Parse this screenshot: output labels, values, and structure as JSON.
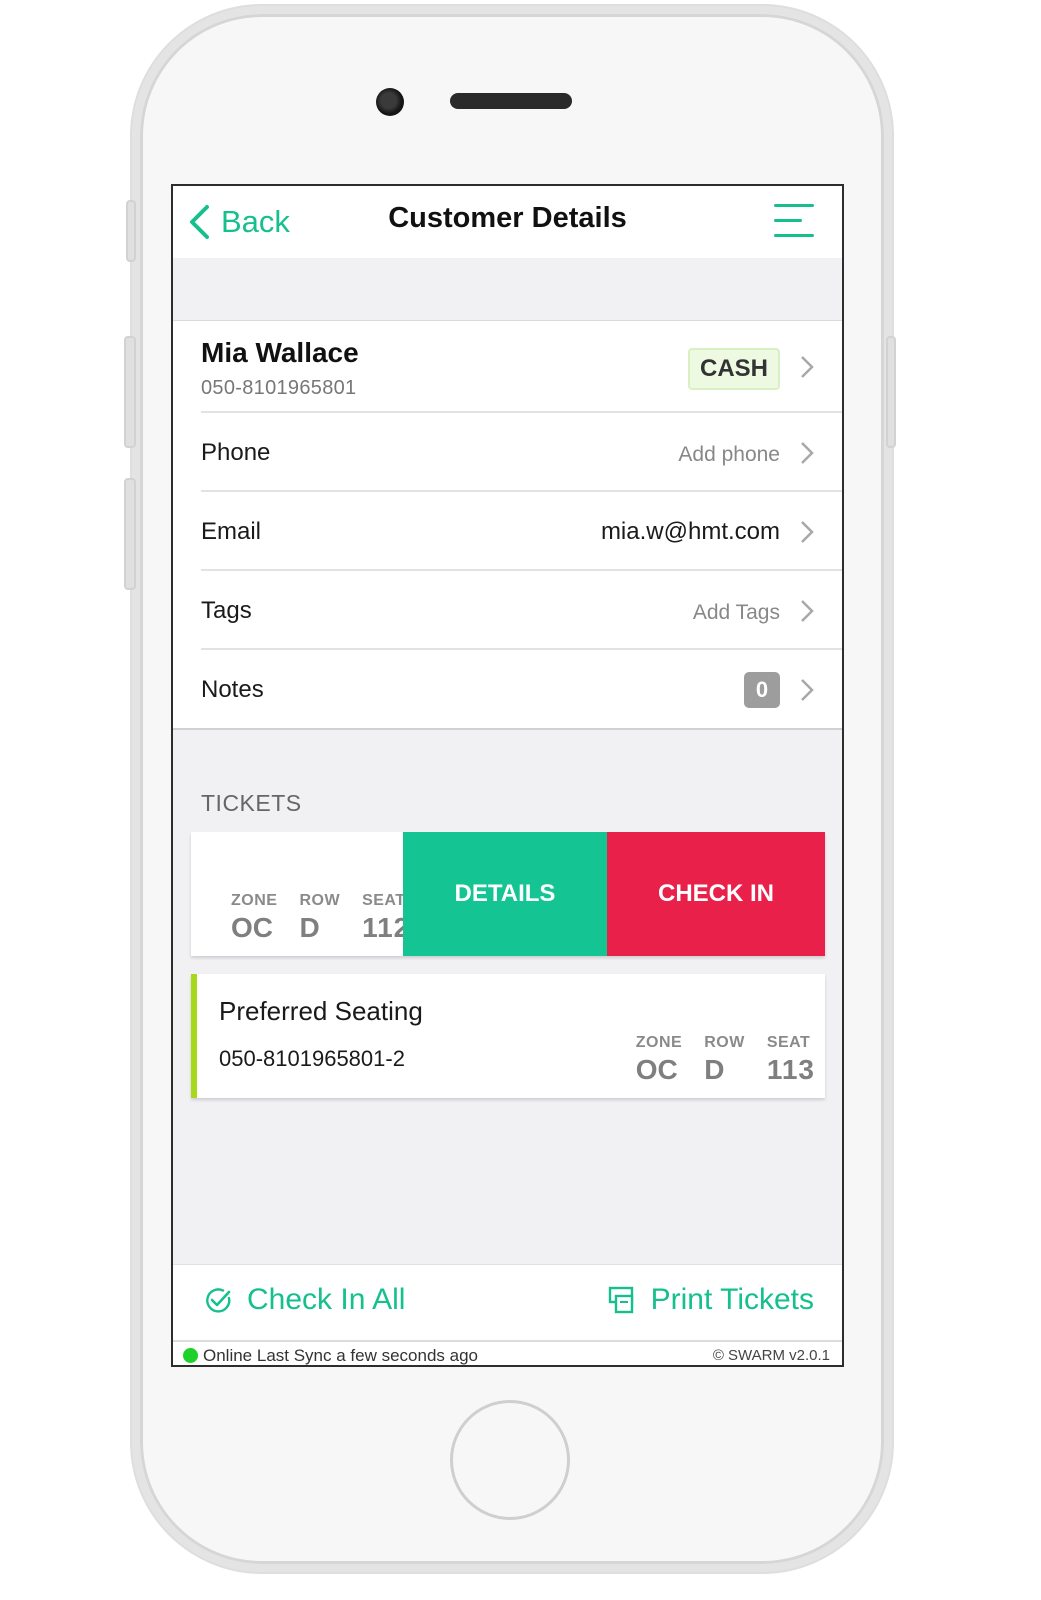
{
  "header": {
    "back_label": "Back",
    "title": "Customer Details"
  },
  "customer": {
    "name": "Mia Wallace",
    "id": "050-8101965801",
    "payment_badge": "CASH"
  },
  "fields": {
    "phone": {
      "label": "Phone",
      "value": "Add phone"
    },
    "email": {
      "label": "Email",
      "value": "mia.w@hmt.com"
    },
    "tags": {
      "label": "Tags",
      "value": "Add Tags"
    },
    "notes": {
      "label": "Notes",
      "count": "0"
    }
  },
  "tickets": {
    "section_title": "TICKETS",
    "seat_headers": {
      "zone": "ZONE",
      "row": "ROW",
      "seat": "SEAT"
    },
    "items": [
      {
        "zone": "OC",
        "row": "D",
        "seat": "112",
        "actions": {
          "details": "DETAILS",
          "check_in": "CHECK IN"
        }
      },
      {
        "name": "Preferred Seating",
        "id": "050-8101965801-2",
        "zone": "OC",
        "row": "D",
        "seat": "113"
      }
    ]
  },
  "actions": {
    "check_in_all": "Check In All",
    "print_tickets": "Print Tickets"
  },
  "status": {
    "text": "Online Last Sync a few seconds ago",
    "version": "© SWARM v2.0.1"
  },
  "colors": {
    "accent": "#16c08e",
    "details": "#14c493",
    "check_in": "#e8204a",
    "ticket_stripe": "#a8d81e",
    "online": "#1ed02a"
  },
  "icons": [
    "chevron-left-icon",
    "menu-icon",
    "chevron-right-icon",
    "check-circle-icon",
    "printer-icon",
    "online-dot-icon"
  ]
}
